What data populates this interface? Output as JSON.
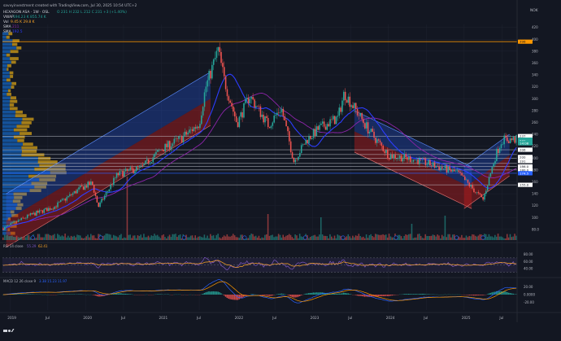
{
  "header": {
    "created_line": "savvyinvestment created with TradingView.com, Jul 30, 2025 10:54 UTC+2",
    "title_line": "HEXAGON ASA · 1W · OSL",
    "ohlc_line": "O 231  H 232  L 212  C 231 +3 (+1.40%)",
    "vwap_label": "VWAP",
    "vwap_value": "194.23 K  855.74 K",
    "vol_label": "Vol",
    "vol_value": "9.45 K  29.8 K",
    "sma_label": "SMA",
    "sma_value": "211",
    "sma2_label": "SMA",
    "sma2_value": "192.5"
  },
  "currency": "NOK",
  "colors": {
    "background": "#131722",
    "grid": "#1f2330",
    "candle_up": "#26a69a",
    "candle_down": "#ef5350",
    "channel_blue": "#2962ff",
    "channel_red": "#b71c1c",
    "ma_blue": "#2d3dff",
    "ma_purple": "#8e24aa",
    "vp_blue": "#1565c0",
    "vp_yellow": "#d4a017",
    "rsi_line": "#7e57c2",
    "rsi_ma": "#ffa726",
    "macd_line": "#2962ff",
    "signal_line": "#ff9800",
    "top_line": "#ff9800"
  },
  "price_axis": {
    "ticks": [
      "420",
      "400",
      "380",
      "360",
      "340",
      "320",
      "300",
      "280",
      "260",
      "240",
      "220",
      "200",
      "180",
      "160",
      "140",
      "120",
      "100",
      "80.0"
    ],
    "badges": [
      {
        "text": "396",
        "price": 396,
        "bg": "#ff9800",
        "fg": "#131722"
      },
      {
        "text": "237",
        "price": 237,
        "bg": "#ffffff",
        "fg": "#131722"
      },
      {
        "text": "HEXA",
        "price": 231,
        "bg": "#26a69a",
        "fg": "#ffffff"
      },
      {
        "text": "231",
        "price": 229,
        "bg": "#26a69a",
        "fg": "#ffffff"
      },
      {
        "text": "14:06",
        "price": 225,
        "bg": "#26a69a",
        "fg": "#ffffff"
      },
      {
        "text": "206",
        "price": 214,
        "bg": "#ffffff",
        "fg": "#131722"
      },
      {
        "text": "200",
        "price": 202,
        "bg": "#ffffff",
        "fg": "#131722"
      },
      {
        "text": "191",
        "price": 195,
        "bg": "#ffffff",
        "fg": "#131722"
      },
      {
        "text": "186.0",
        "price": 186,
        "bg": "#ffffff",
        "fg": "#131722"
      },
      {
        "text": "180.0",
        "price": 180,
        "bg": "#ffffff",
        "fg": "#131722"
      },
      {
        "text": "174.5",
        "price": 174.5,
        "bg": "#2962ff",
        "fg": "#ffffff"
      },
      {
        "text": "155.0",
        "price": 155,
        "bg": "#ffffff",
        "fg": "#131722"
      }
    ]
  },
  "time_axis": [
    "2019",
    "Jul",
    "2020",
    "Jul",
    "2021",
    "Jul",
    "2022",
    "Jul",
    "2023",
    "Jul",
    "2024",
    "Jul",
    "2025",
    "Jul"
  ],
  "chart_data": {
    "type": "candlestick",
    "interval": "1W",
    "ylim": [
      62,
      425
    ],
    "x_range": [
      "2019",
      "2025-07"
    ],
    "horizontal_levels": [
      396,
      237,
      214,
      206,
      200,
      191,
      186,
      180,
      174.5,
      155
    ],
    "price_path": [
      [
        "2018-12",
        82
      ],
      [
        "2019-04",
        103
      ],
      [
        "2019-08",
        118
      ],
      [
        "2019-12",
        148
      ],
      [
        "2020-02",
        158
      ],
      [
        "2020-03",
        118
      ],
      [
        "2020-06",
        172
      ],
      [
        "2020-10",
        185
      ],
      [
        "2021-01",
        215
      ],
      [
        "2021-04",
        232
      ],
      [
        "2021-07",
        258
      ],
      [
        "2021-08",
        318
      ],
      [
        "2021-10",
        382
      ],
      [
        "2021-11",
        330
      ],
      [
        "2022-01",
        258
      ],
      [
        "2022-03",
        305
      ],
      [
        "2022-06",
        255
      ],
      [
        "2022-08",
        285
      ],
      [
        "2022-10",
        195
      ],
      [
        "2022-12",
        230
      ],
      [
        "2023-02",
        250
      ],
      [
        "2023-05",
        268
      ],
      [
        "2023-06",
        310
      ],
      [
        "2023-08",
        278
      ],
      [
        "2023-10",
        245
      ],
      [
        "2024-01",
        205
      ],
      [
        "2024-05",
        198
      ],
      [
        "2024-09",
        185
      ],
      [
        "2024-12",
        175
      ],
      [
        "2025-04",
        130
      ],
      [
        "2025-06",
        205
      ],
      [
        "2025-07",
        231
      ]
    ],
    "rsi": {
      "label": "RSI 14 close",
      "value": "55.29",
      "ma_value": "62.41",
      "ticks": [
        "80.00",
        "60.00",
        "40.00"
      ],
      "levels": [
        70,
        50,
        30
      ]
    },
    "macd": {
      "label": "MACD 12 26 close 9",
      "values": "3.38  15.23  11.97",
      "ticks": [
        "20.00",
        "0.0000",
        "-20.00"
      ]
    }
  }
}
